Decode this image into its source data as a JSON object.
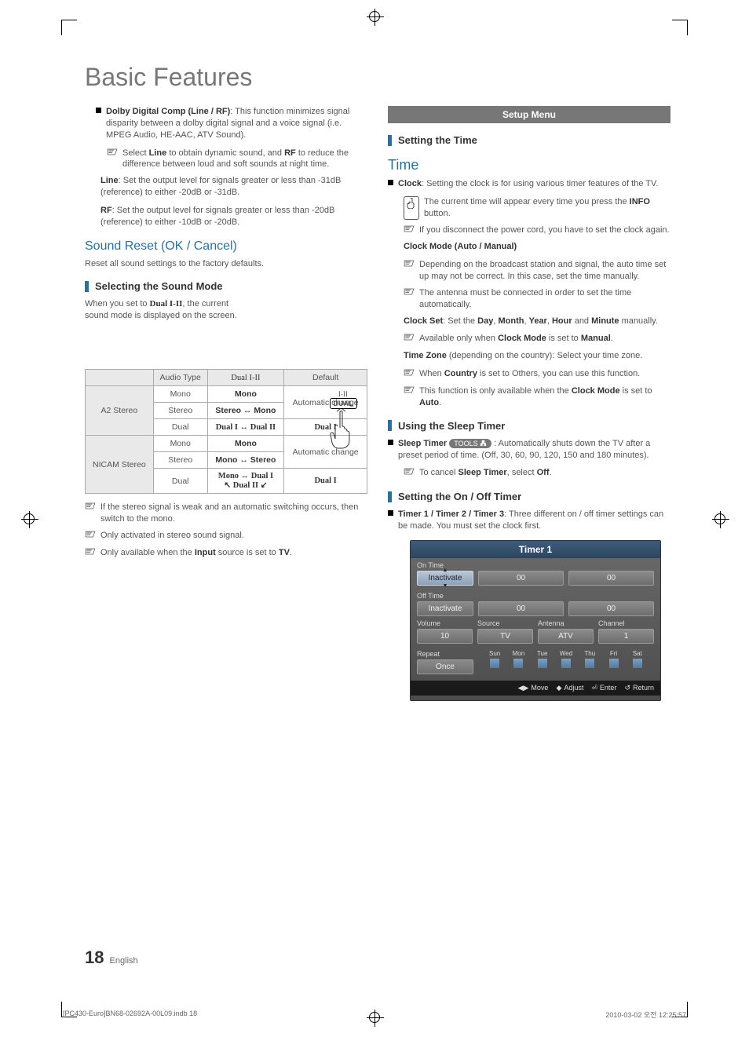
{
  "title": "Basic Features",
  "left": {
    "dolby": {
      "label": "Dolby Digital Comp (Line / RF)",
      "desc": ": This function minimizes signal disparity between a dolby digital signal and a voice signal (i.e. MPEG Audio, HE-AAC, ATV Sound).",
      "note1_a": "Select ",
      "note1_b": "Line",
      "note1_c": " to obtain dynamic sound, and ",
      "note1_d": "RF",
      "note1_e": " to reduce the difference between loud and soft sounds at night time.",
      "line_lbl": "Line",
      "line_txt": ": Set the output level for signals greater or less than -31dB (reference) to either -20dB or -31dB.",
      "rf_lbl": "RF",
      "rf_txt": ": Set the output level for signals greater or less than -20dB (reference) to either -10dB or -20dB."
    },
    "reset_h": "Sound Reset (OK / Cancel)",
    "reset_txt": "Reset all sound settings to the factory defaults.",
    "sel_h": "Selecting the Sound Mode",
    "sel_txt_a": "When you set to ",
    "sel_txt_b": "Dual I-II",
    "sel_txt_c": ", the current sound mode is displayed on the screen.",
    "dual_badge_top": "I-II",
    "dual_badge": "DUAL",
    "table": {
      "h1": "Audio Type",
      "h2": "Dual I-II",
      "h3": "Default",
      "rows": [
        {
          "grp": "A2 Stereo",
          "at": "Mono",
          "dual": "Mono",
          "def": "Automatic change"
        },
        {
          "grp": "",
          "at": "Stereo",
          "dual": "Stereo ↔ Mono",
          "def": ""
        },
        {
          "grp": "",
          "at": "Dual",
          "dual": "Dual I ↔ Dual II",
          "def": "Dual I"
        },
        {
          "grp": "NICAM Stereo",
          "at": "Mono",
          "dual": "Mono",
          "def": "Automatic change"
        },
        {
          "grp": "",
          "at": "Stereo",
          "dual": "Mono ↔ Stereo",
          "def": ""
        },
        {
          "grp": "",
          "at": "Dual",
          "dual": "Mono ↔ Dual I\n↖ Dual II ↙",
          "def": "Dual I"
        }
      ]
    },
    "n1": "If the stereo signal is weak and an automatic switching occurs, then switch to the mono.",
    "n2": "Only activated in stereo sound signal.",
    "n3_a": "Only available when the ",
    "n3_b": "Input",
    "n3_c": " source is set to ",
    "n3_d": "TV",
    "n3_e": "."
  },
  "right": {
    "setup_bar": "Setup Menu",
    "time_h": "Setting the Time",
    "time_sec": "Time",
    "clock_lbl": "Clock",
    "clock_txt": ": Setting the clock is for using various timer features of the TV.",
    "info_note_a": "The current time will appear every time you press the ",
    "info_note_b": "INFO",
    "info_note_c": " button.",
    "disc_note": "If you disconnect the power cord, you have to set the clock again.",
    "cm_lbl": "Clock Mode (Auto / Manual)",
    "cm_n1": "Depending on the broadcast station and signal, the auto time set up may not be correct. In this case, set the time manually.",
    "cm_n2": "The antenna must be connected in order to set the time automatically.",
    "cs_lbl": "Clock Set",
    "cs_txt_a": ": Set the ",
    "cs_txt_b": "Day",
    "cs_txt_c": ", ",
    "cs_txt_d": "Month",
    "cs_txt_e": ", ",
    "cs_txt_f": "Year",
    "cs_txt_g": ", ",
    "cs_txt_h": "Hour",
    "cs_txt_i": " and ",
    "cs_txt_j": "Minute",
    "cs_txt_k": " manually.",
    "cs_n_a": "Available only when ",
    "cs_n_b": "Clock Mode",
    "cs_n_c": " is set to ",
    "cs_n_d": "Manual",
    "cs_n_e": ".",
    "tz_lbl": "Time Zone",
    "tz_txt": " (depending on the country): Select your time zone.",
    "tz_n1_a": "When ",
    "tz_n1_b": "Country",
    "tz_n1_c": " is set to Others, you can use this function.",
    "tz_n2_a": "This function is only available when the ",
    "tz_n2_b": "Clock Mode",
    "tz_n2_c": " is set to ",
    "tz_n2_d": "Auto",
    "tz_n2_e": ".",
    "sleep_h": "Using the Sleep Timer",
    "sleep_lbl": "Sleep Timer",
    "sleep_tools": "TOOLS",
    "sleep_txt": " : Automatically shuts down the TV after a preset period of time. (Off, 30, 60, 90, 120, 150 and 180 minutes).",
    "sleep_n_a": "To cancel ",
    "sleep_n_b": "Sleep Timer",
    "sleep_n_c": ", select ",
    "sleep_n_d": "Off",
    "sleep_n_e": ".",
    "onoff_h": "Setting the On / Off Timer",
    "onoff_lbl": "Timer 1 / Timer 2 / Timer 3",
    "onoff_txt": ": Three different on / off timer settings can be made. You must set the clock first.",
    "panel": {
      "title": "Timer 1",
      "on_lbl": "On Time",
      "off_lbl": "Off Time",
      "state": "Inactivate",
      "zero": "00",
      "vol_lbl": "Volume",
      "src_lbl": "Source",
      "ant_lbl": "Antenna",
      "ch_lbl": "Channel",
      "vol": "10",
      "src": "TV",
      "ant": "ATV",
      "ch": "1",
      "rep_lbl": "Repeat",
      "rep": "Once",
      "days": [
        "Sun",
        "Mon",
        "Tue",
        "Wed",
        "Thu",
        "Fri",
        "Sat"
      ],
      "move": "Move",
      "adjust": "Adjust",
      "enter": "Enter",
      "return": "Return"
    }
  },
  "page_num": "18",
  "page_lang": "English",
  "footer_left": "[PC430-Euro]BN68-02692A-00L09.indb   18",
  "footer_right": "2010-03-02   오전 12:25:57"
}
